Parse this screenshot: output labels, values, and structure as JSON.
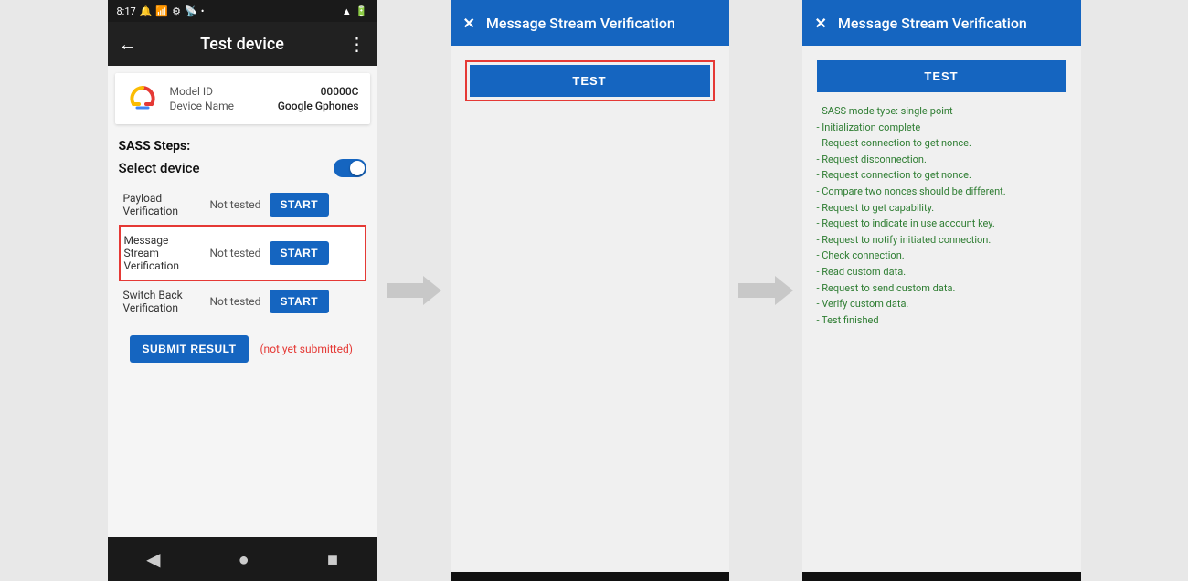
{
  "phone": {
    "status_bar": {
      "time": "8:17",
      "icons": [
        "notification",
        "sim",
        "settings",
        "cast",
        "battery"
      ]
    },
    "app_bar": {
      "title": "Test device",
      "back_icon": "←",
      "menu_icon": "⋮"
    },
    "device_info": {
      "model_id_label": "Model ID",
      "model_id_value": "00000C",
      "device_name_label": "Device Name",
      "device_name_value": "Google Gphones"
    },
    "sass_title": "SASS Steps:",
    "select_device_label": "Select device",
    "steps": [
      {
        "name": "Payload Verification",
        "status": "Not tested",
        "btn_label": "START"
      },
      {
        "name": "Message Stream Verification",
        "status": "Not tested",
        "btn_label": "START",
        "highlighted": true
      },
      {
        "name": "Switch Back Verification",
        "status": "Not tested",
        "btn_label": "START"
      }
    ],
    "submit_btn_label": "SUBMIT RESULT",
    "not_submitted_label": "(not yet submitted)",
    "nav": {
      "back": "◀",
      "home": "●",
      "recent": "■"
    }
  },
  "dialog1": {
    "close_icon": "✕",
    "title": "Message Stream Verification",
    "test_btn_label": "TEST"
  },
  "dialog2": {
    "close_icon": "✕",
    "title": "Message Stream Verification",
    "test_btn_label": "TEST",
    "log_lines": [
      "- SASS mode type: single-point",
      "- Initialization complete",
      "- Request connection to get nonce.",
      "- Request disconnection.",
      "- Request connection to get nonce.",
      "- Compare two nonces should be different.",
      "- Request to get capability.",
      "- Request to indicate in use account key.",
      "- Request to notify initiated connection.",
      "- Check connection.",
      "- Read custom data.",
      "- Request to send custom data.",
      "- Verify custom data.",
      "- Test finished"
    ]
  },
  "colors": {
    "primary_blue": "#1565c0",
    "red_highlight": "#e53935",
    "green_log": "#2e7d32",
    "dark_bg": "#212121"
  }
}
